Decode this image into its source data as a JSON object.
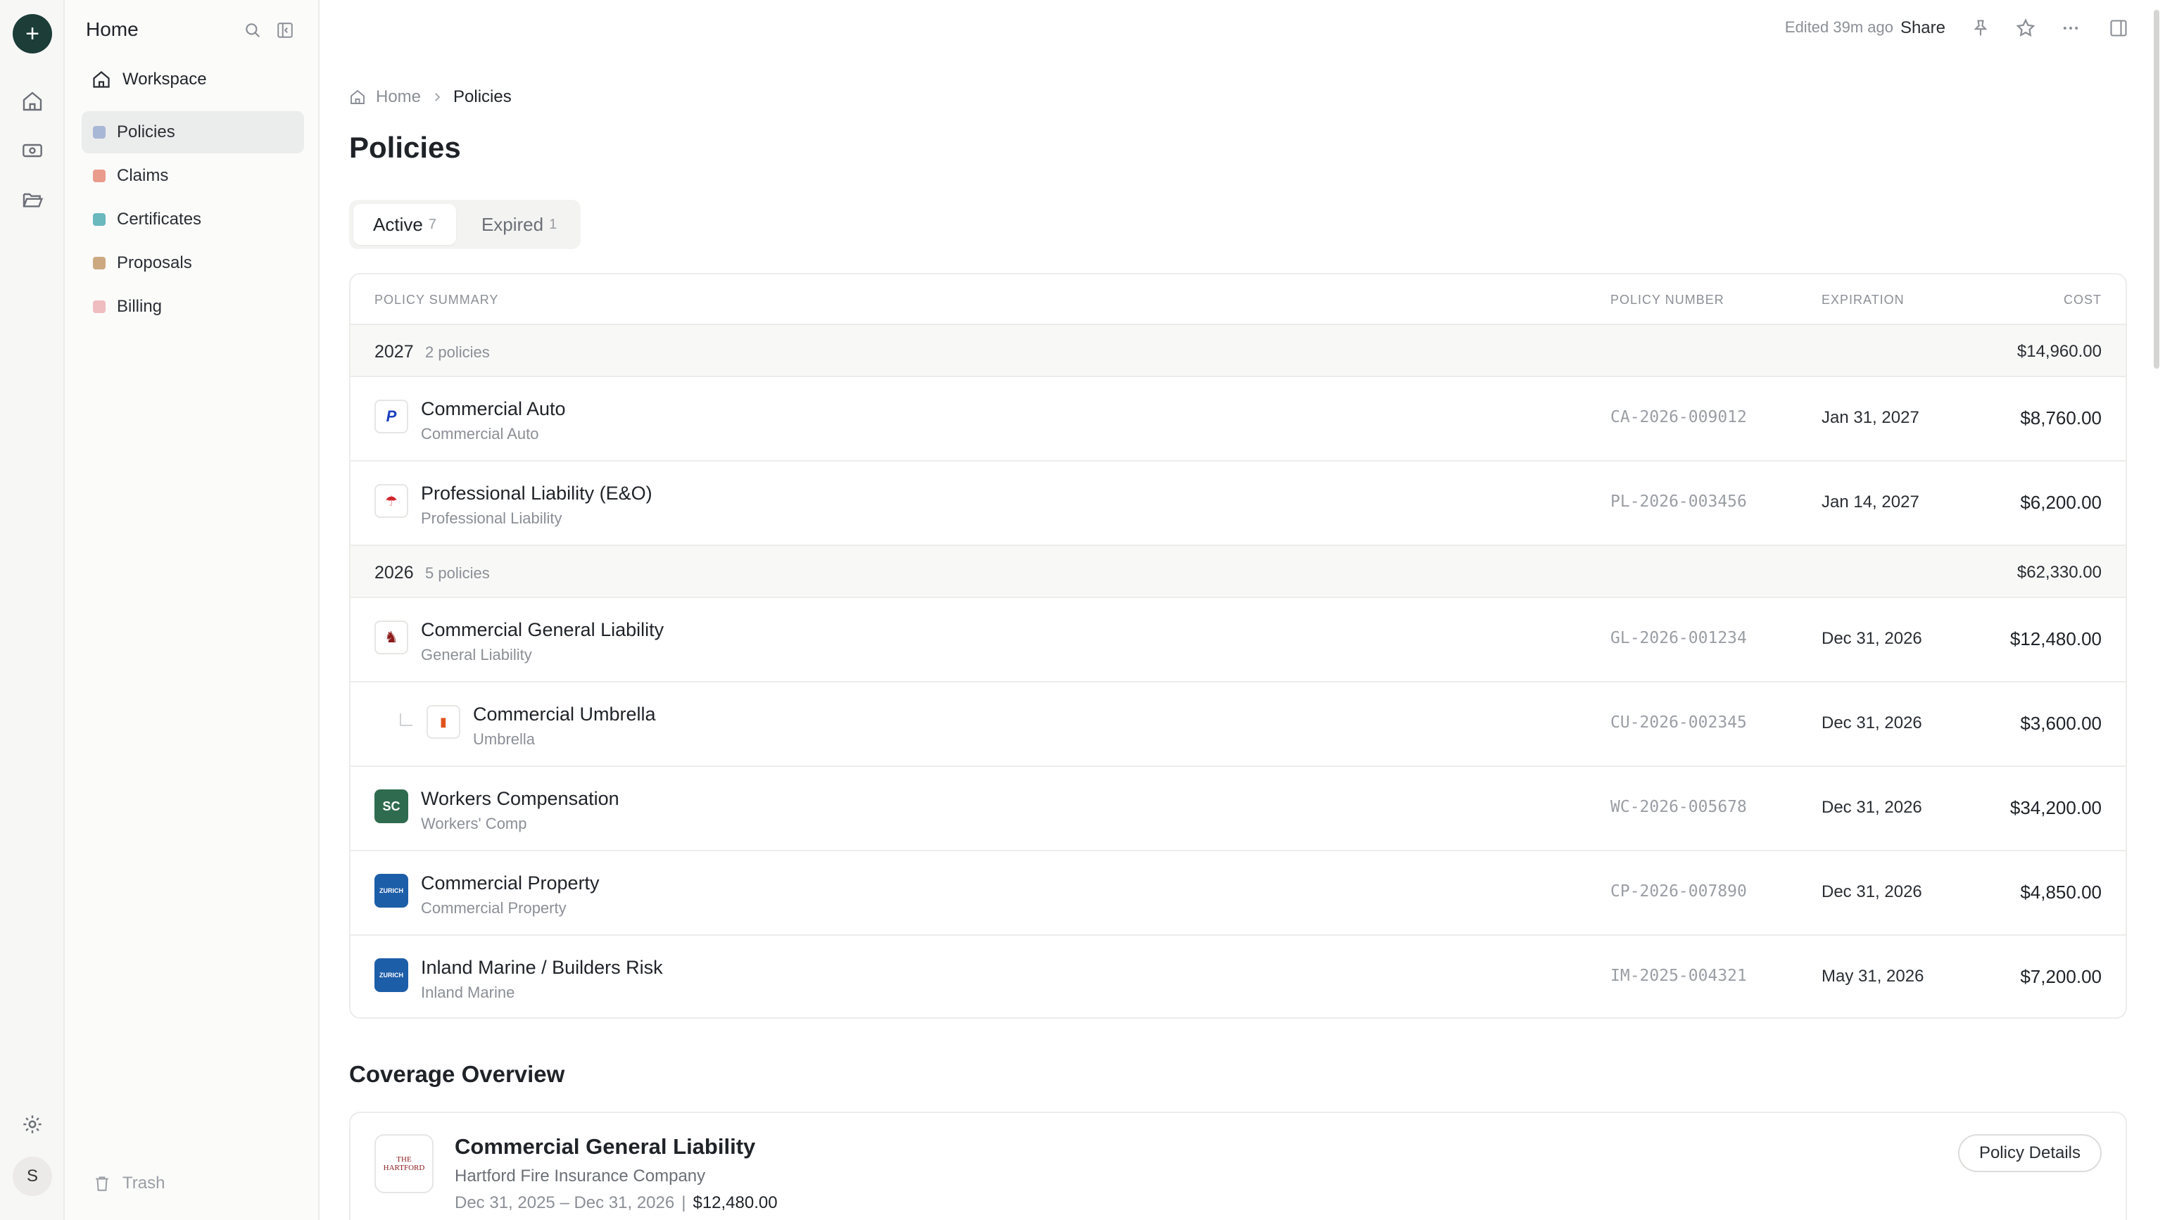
{
  "sidebar": {
    "title": "Home",
    "workspace_label": "Workspace",
    "items": [
      {
        "label": "Policies",
        "color": "#a9b7d6",
        "active": true
      },
      {
        "label": "Claims",
        "color": "#ea9c8c"
      },
      {
        "label": "Certificates",
        "color": "#6bb8bd"
      },
      {
        "label": "Proposals",
        "color": "#cda982"
      },
      {
        "label": "Billing",
        "color": "#efbcc0"
      }
    ],
    "trash_label": "Trash"
  },
  "rail": {
    "new_icon": "plus-icon",
    "avatar_initial": "S"
  },
  "topbar": {
    "edited": "Edited 39m ago",
    "share": "Share"
  },
  "breadcrumb": {
    "home": "Home",
    "current": "Policies"
  },
  "page_title": "Policies",
  "tabs": [
    {
      "label": "Active",
      "count": "7",
      "active": true
    },
    {
      "label": "Expired",
      "count": "1"
    }
  ],
  "table": {
    "headers": {
      "summary": "POLICY SUMMARY",
      "number": "POLICY NUMBER",
      "expiration": "EXPIRATION",
      "cost": "COST"
    },
    "groups": [
      {
        "year": "2027",
        "count_label": "2 policies",
        "total": "$14,960.00",
        "rows": [
          {
            "name": "Commercial Auto",
            "type": "Commercial Auto",
            "number": "CA-2026-009012",
            "expiration": "Jan 31, 2027",
            "cost": "$8,760.00",
            "logo": "P"
          },
          {
            "name": "Professional Liability (E&O)",
            "type": "Professional Liability",
            "number": "PL-2026-003456",
            "expiration": "Jan 14, 2027",
            "cost": "$6,200.00",
            "logo": "☂"
          }
        ]
      },
      {
        "year": "2026",
        "count_label": "5 policies",
        "total": "$62,330.00",
        "rows": [
          {
            "name": "Commercial General Liability",
            "type": "General Liability",
            "number": "GL-2026-001234",
            "expiration": "Dec 31, 2026",
            "cost": "$12,480.00",
            "logo": "♞"
          },
          {
            "name": "Commercial Umbrella",
            "type": "Umbrella",
            "number": "CU-2026-002345",
            "expiration": "Dec 31, 2026",
            "cost": "$3,600.00",
            "logo": "▮"
          },
          {
            "name": "Workers Compensation",
            "type": "Workers' Comp",
            "number": "WC-2026-005678",
            "expiration": "Dec 31, 2026",
            "cost": "$34,200.00",
            "logo": "SC"
          },
          {
            "name": "Commercial Property",
            "type": "Commercial Property",
            "number": "CP-2026-007890",
            "expiration": "Dec 31, 2026",
            "cost": "$4,850.00",
            "logo": "ZURICH"
          },
          {
            "name": "Inland Marine / Builders Risk",
            "type": "Inland Marine",
            "number": "IM-2025-004321",
            "expiration": "May 31, 2026",
            "cost": "$7,200.00",
            "logo": "ZURICH"
          }
        ]
      }
    ]
  },
  "coverage": {
    "title": "Coverage Overview",
    "card": {
      "name": "Commercial General Liability",
      "carrier": "Hartford Fire Insurance Company",
      "dates": "Dec 31, 2025 – Dec 31, 2026",
      "separator": "|",
      "amount": "$12,480.00",
      "button": "Policy Details",
      "logo_text": "THE HARTFORD"
    }
  }
}
